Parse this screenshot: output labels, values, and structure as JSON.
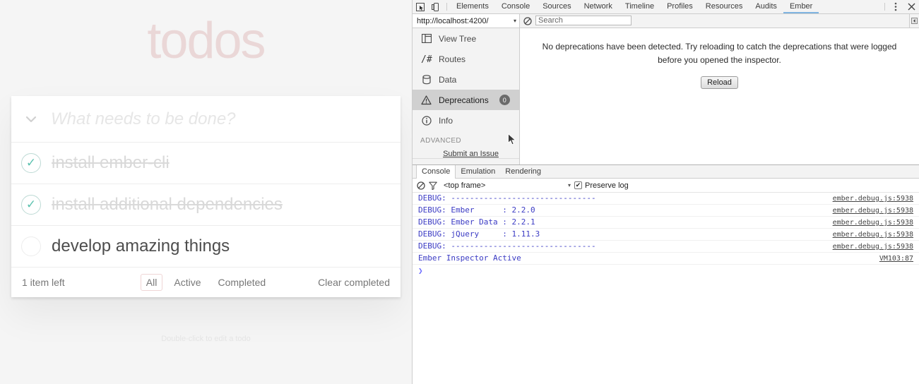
{
  "app": {
    "title": "todos",
    "new_todo_placeholder": "What needs to be done?",
    "toggle_all_icon": "chevron-down-icon",
    "items": [
      {
        "label": "install ember-cli",
        "completed": true,
        "check_glyph": "✓"
      },
      {
        "label": "install additional dependencies",
        "completed": true,
        "check_glyph": "✓"
      },
      {
        "label": "develop amazing things",
        "completed": false,
        "check_glyph": ""
      }
    ],
    "footer": {
      "count_text": "1 item left",
      "filters": [
        {
          "label": "All",
          "selected": true
        },
        {
          "label": "Active",
          "selected": false
        },
        {
          "label": "Completed",
          "selected": false
        }
      ],
      "clear_label": "Clear completed"
    },
    "info_text": "Double-click to edit a todo",
    "accent_color": "#af2f2f",
    "title_color": "#ead7d7",
    "check_color": "#5dc2af"
  },
  "devtools": {
    "inspect_icon": "inspect-element-icon",
    "device_icon": "device-toolbar-icon",
    "tabs": [
      {
        "label": "Elements",
        "active": false
      },
      {
        "label": "Console",
        "active": false
      },
      {
        "label": "Sources",
        "active": false
      },
      {
        "label": "Network",
        "active": false
      },
      {
        "label": "Timeline",
        "active": false
      },
      {
        "label": "Profiles",
        "active": false
      },
      {
        "label": "Resources",
        "active": false
      },
      {
        "label": "Audits",
        "active": false
      },
      {
        "label": "Ember",
        "active": true
      }
    ],
    "more_icon": "vertical-dots-icon",
    "close_icon": "close-icon",
    "active_tab_underline": "#7fb4e0"
  },
  "ember": {
    "app_select_value": "http://localhost:4200/",
    "app_select_caret": "▾",
    "clear_icon": "clear-console-icon",
    "search_placeholder": "Search",
    "search_value": "",
    "scroll_nub_icon": "scroll-left-icon",
    "nav": [
      {
        "label": "View Tree",
        "icon": "view-tree-icon",
        "active": false,
        "badge": ""
      },
      {
        "label": "Routes",
        "icon": "routes-hash-icon",
        "active": false,
        "badge": ""
      },
      {
        "label": "Data",
        "icon": "database-icon",
        "active": false,
        "badge": ""
      },
      {
        "label": "Deprecations",
        "icon": "warning-triangle-icon",
        "active": true,
        "badge": "0"
      },
      {
        "label": "Info",
        "icon": "info-circle-icon",
        "active": false,
        "badge": ""
      }
    ],
    "section_label": "ADVANCED",
    "submit_issue_label": "Submit an Issue",
    "empty_message": "No deprecations have been detected. Try reloading to catch the deprecations that were logged before you opened the inspector.",
    "reload_label": "Reload"
  },
  "drawer": {
    "tabs": [
      {
        "label": "Console",
        "active": true
      },
      {
        "label": "Emulation",
        "active": false
      },
      {
        "label": "Rendering",
        "active": false
      }
    ],
    "clear_icon": "clear-console-icon",
    "filter_icon": "filter-funnel-icon",
    "context_value": "<top frame>",
    "context_caret": "▾",
    "preserve_log_label": "Preserve log",
    "preserve_log_checked": true,
    "preserve_checkmark": "✔",
    "prompt_glyph": "❯",
    "log_color": "#3b3bc4",
    "rows": [
      {
        "text": "DEBUG: -------------------------------",
        "source": "ember.debug.js:5938"
      },
      {
        "text": "DEBUG: Ember      : 2.2.0",
        "source": "ember.debug.js:5938"
      },
      {
        "text": "DEBUG: Ember Data : 2.2.1",
        "source": "ember.debug.js:5938"
      },
      {
        "text": "DEBUG: jQuery     : 1.11.3",
        "source": "ember.debug.js:5938"
      },
      {
        "text": "DEBUG: -------------------------------",
        "source": "ember.debug.js:5938"
      },
      {
        "text": "Ember Inspector Active",
        "source": "VM103:87"
      }
    ]
  }
}
